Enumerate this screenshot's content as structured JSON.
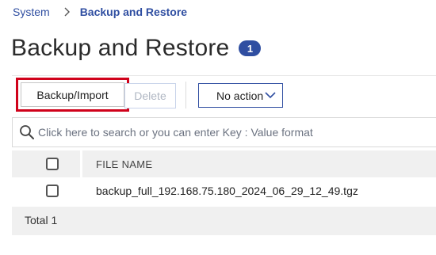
{
  "breadcrumb": {
    "parent": "System",
    "current": "Backup and Restore"
  },
  "page": {
    "title": "Backup and Restore",
    "count": "1"
  },
  "toolbar": {
    "backup_label": "Backup/Import",
    "delete_label": "Delete",
    "action_select_value": "No action"
  },
  "search": {
    "placeholder": "Click here to search or you can enter Key : Value format"
  },
  "table": {
    "columns": [
      "FILE NAME"
    ],
    "rows": [
      {
        "file_name": "backup_full_192.168.75.180_2024_06_29_12_49.tgz"
      }
    ],
    "footer": "Total 1"
  },
  "colors": {
    "accent": "#2f4ea1",
    "highlight": "#d0021b"
  }
}
